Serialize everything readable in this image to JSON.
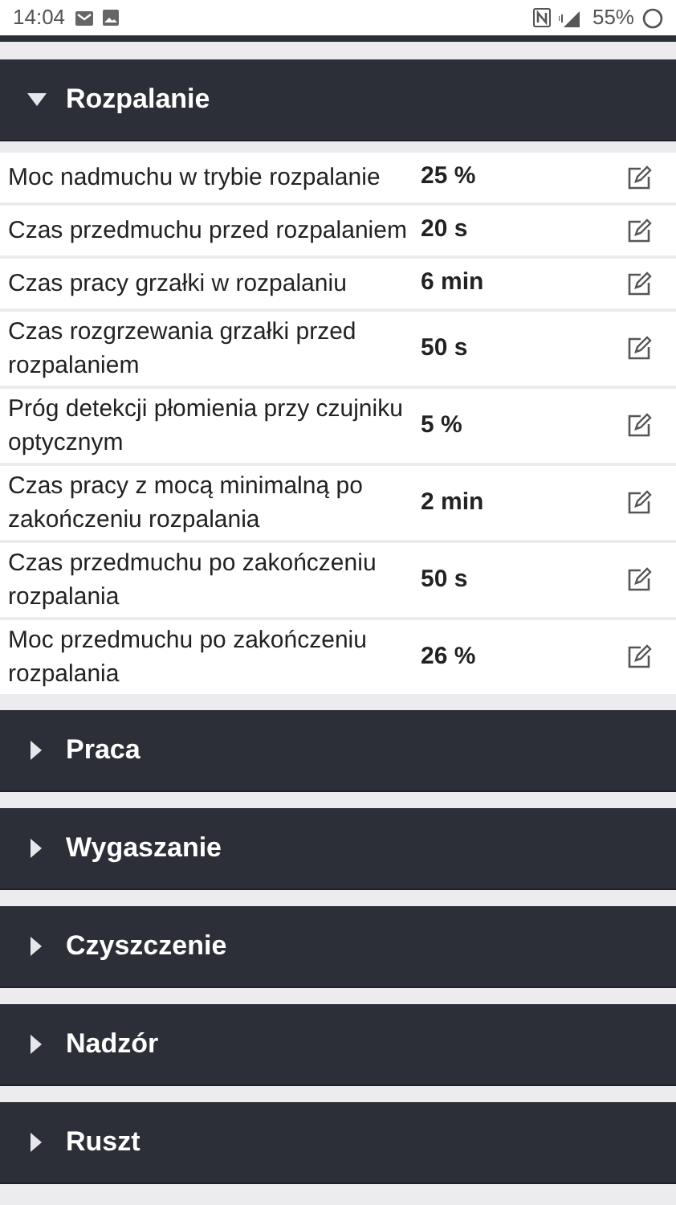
{
  "status_bar": {
    "time": "14:04",
    "battery": "55%"
  },
  "sections": [
    {
      "title": "Rozpalanie",
      "expanded": true,
      "rows": [
        {
          "label": "Moc nadmuchu w trybie rozpalanie",
          "value": "25 %"
        },
        {
          "label": "Czas przedmuchu przed rozpalaniem",
          "value": "20 s"
        },
        {
          "label": "Czas pracy grzałki w rozpalaniu",
          "value": "6 min"
        },
        {
          "label": "Czas rozgrzewania grzałki przed rozpalaniem",
          "value": "50 s"
        },
        {
          "label": "Próg detekcji płomienia przy czujniku optycznym",
          "value": "5 %"
        },
        {
          "label": "Czas pracy z mocą minimalną po zakończeniu rozpalania",
          "value": "2 min"
        },
        {
          "label": "Czas przedmuchu po zakończeniu rozpalania",
          "value": "50 s"
        },
        {
          "label": "Moc przedmuchu po zakończeniu rozpalania",
          "value": "26 %"
        }
      ]
    },
    {
      "title": "Praca",
      "expanded": false
    },
    {
      "title": "Wygaszanie",
      "expanded": false
    },
    {
      "title": "Czyszczenie",
      "expanded": false
    },
    {
      "title": "Nadzór",
      "expanded": false
    },
    {
      "title": "Ruszt",
      "expanded": false
    }
  ]
}
